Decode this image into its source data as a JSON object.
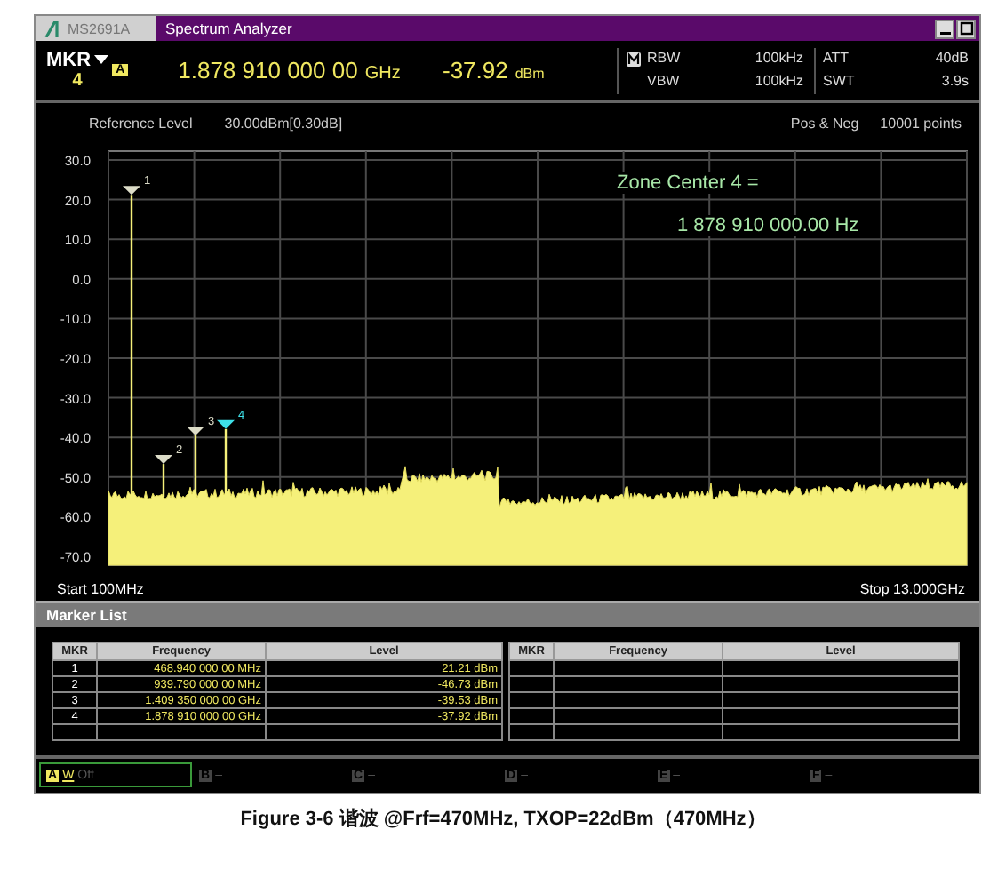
{
  "title_bar": {
    "model": "MS2691A",
    "app": "Spectrum Analyzer"
  },
  "marker_readout": {
    "label": "MKR",
    "number": "4",
    "trace_badge": "A",
    "frequency": "1.878 910 000 00",
    "frequency_unit": "GHz",
    "level": "-37.92",
    "level_unit": "dBm"
  },
  "bandwidth": [
    {
      "label": "RBW",
      "value": "100kHz"
    },
    {
      "label": "VBW",
      "value": "100kHz"
    }
  ],
  "sweep": [
    {
      "label": "ATT",
      "value": "40dB"
    },
    {
      "label": "SWT",
      "value": "3.9s"
    }
  ],
  "info_row": {
    "ref_label": "Reference Level",
    "ref_value": "30.00dBm[0.30dB]",
    "detector": "Pos & Neg",
    "points": "10001 points"
  },
  "graph": {
    "y_labels": [
      "30.0",
      "20.0",
      "10.0",
      "0.0",
      "-10.0",
      "-20.0",
      "-30.0",
      "-40.0",
      "-50.0",
      "-60.0",
      "-70.0"
    ],
    "markers": [
      {
        "label": "1",
        "selected": false
      },
      {
        "label": "2",
        "selected": false
      },
      {
        "label": "3",
        "selected": false
      },
      {
        "label": "4",
        "selected": true
      }
    ],
    "zone_center": {
      "title": "Zone Center 4 =",
      "value": "1 878 910 000.00 Hz"
    },
    "start": "Start 100MHz",
    "stop": "Stop 13.000GHz"
  },
  "marker_list": {
    "title": "Marker List",
    "columns": [
      "MKR",
      "Frequency",
      "Level"
    ],
    "rows": [
      {
        "mkr": "1",
        "frequency": "468.940 000 00 MHz",
        "level": "21.21 dBm"
      },
      {
        "mkr": "2",
        "frequency": "939.790 000 00 MHz",
        "level": "-46.73 dBm"
      },
      {
        "mkr": "3",
        "frequency": "1.409 350 000 00 GHz",
        "level": "-39.53 dBm"
      },
      {
        "mkr": "4",
        "frequency": "1.878 910 000 00 GHz",
        "level": "-37.92 dBm"
      }
    ],
    "right_columns": [
      "MKR",
      "Frequency",
      "Level"
    ]
  },
  "traces": [
    {
      "letter": "A",
      "mode": "W",
      "status": "Off",
      "selected": true
    },
    {
      "letter": "B",
      "status": "–",
      "selected": false
    },
    {
      "letter": "C",
      "status": "–",
      "selected": false
    },
    {
      "letter": "D",
      "status": "–",
      "selected": false
    },
    {
      "letter": "E",
      "status": "–",
      "selected": false
    },
    {
      "letter": "F",
      "status": "–",
      "selected": false
    }
  ],
  "caption": "Figure 3-6 谐波 @Frf=470MHz, TXOP=22dBm（470MHz）"
}
